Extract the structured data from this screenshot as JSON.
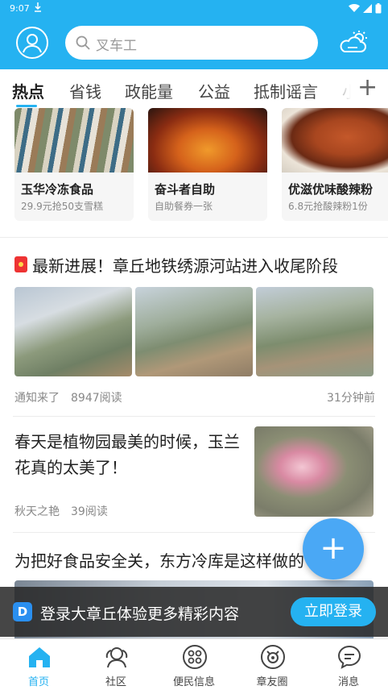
{
  "status_bar": {
    "time": "9:07"
  },
  "header": {
    "search_placeholder": "叉车工"
  },
  "tabs": [
    {
      "label": "热点",
      "active": true
    },
    {
      "label": "省钱"
    },
    {
      "label": "政能量"
    },
    {
      "label": "公益"
    },
    {
      "label": "抵制谣言"
    },
    {
      "label": "小"
    }
  ],
  "deals": [
    {
      "name": "玉华冷冻食品",
      "sub": "29.9元抢50支雪糕"
    },
    {
      "name": "奋斗者自助",
      "sub": "自助餐券一张"
    },
    {
      "name": "优滋优味酸辣粉",
      "sub": "6.8元抢酸辣粉1份"
    }
  ],
  "news1": {
    "title": "最新进展！章丘地铁绣源河站进入收尾阶段",
    "source": "通知来了",
    "reads": "8947阅读",
    "time": "31分钟前"
  },
  "news2": {
    "title": "春天是植物园最美的时候，玉兰花真的太美了！",
    "source": "秋天之艳",
    "reads": "39阅读"
  },
  "news3": {
    "title": "为把好食品安全关，东方冷库是这样做的"
  },
  "login_banner": {
    "logo": "D",
    "text": "登录大章丘体验更多精彩内容",
    "button": "立即登录"
  },
  "fab": {
    "label": "+"
  },
  "bottom_nav": [
    {
      "label": "首页",
      "icon": "home-icon",
      "active": true
    },
    {
      "label": "社区",
      "icon": "community-icon"
    },
    {
      "label": "便民信息",
      "icon": "services-icon"
    },
    {
      "label": "章友圈",
      "icon": "friends-circle-icon"
    },
    {
      "label": "消息",
      "icon": "message-icon"
    }
  ],
  "colors": {
    "accent": "#25b2f1",
    "fab": "#4aa8f5",
    "banner_bg": "#282828"
  }
}
